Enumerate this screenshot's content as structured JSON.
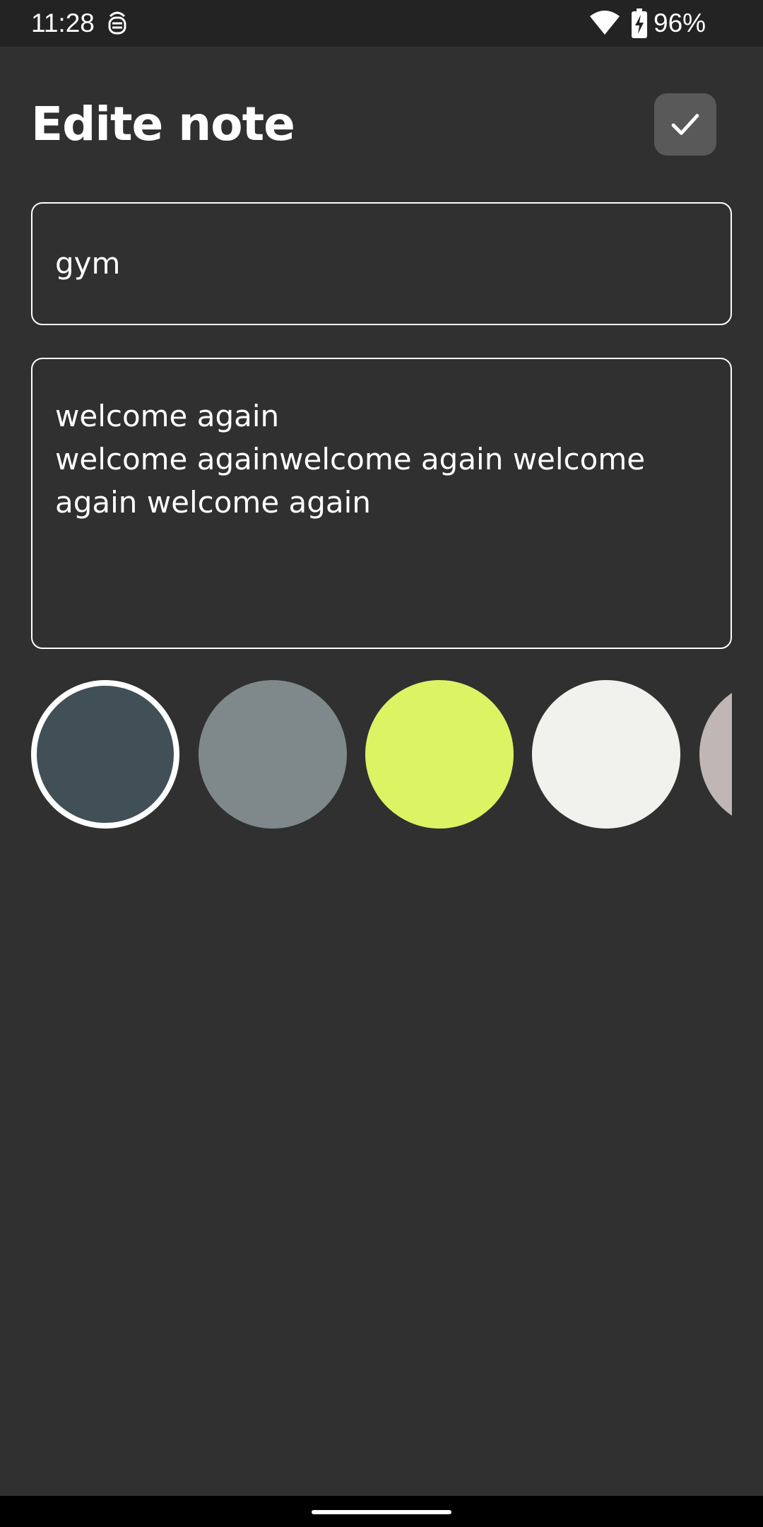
{
  "status_bar": {
    "time": "11:28",
    "battery": "96%",
    "icons": [
      "debug-icon",
      "wifi-icon",
      "battery-charging-icon"
    ]
  },
  "header": {
    "title": "Edite note",
    "save_icon": "checkmark-icon"
  },
  "note": {
    "title_value": "gym",
    "content_lines": [
      "welcome again",
      "welcome againwelcome again welcome",
      "again welcome again"
    ]
  },
  "colors": {
    "background": "#303030",
    "save_button_bg": "#595959",
    "swatches": [
      "#414f57",
      "#7f898b",
      "#dcf364",
      "#f1f1ed",
      "#c0b6b5"
    ],
    "selected_index": 0
  }
}
